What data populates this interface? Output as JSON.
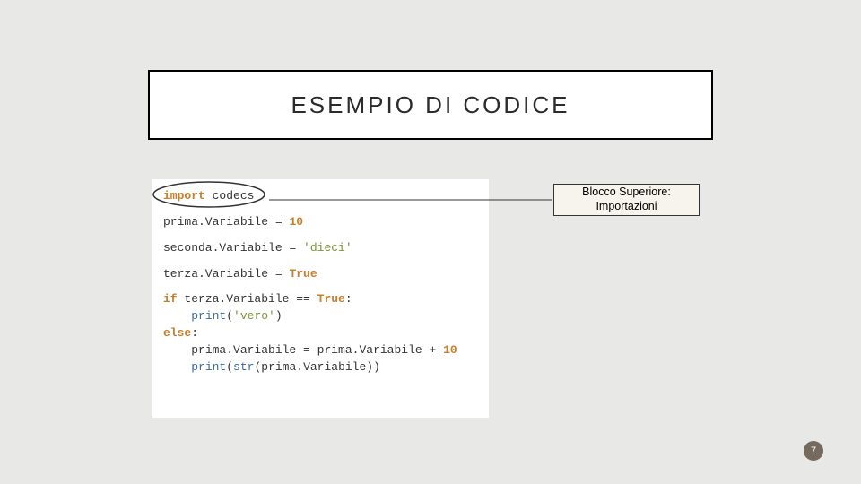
{
  "title": "ESEMPIO DI CODICE",
  "annotation": {
    "line1": "Blocco Superiore:",
    "line2": "Importazioni"
  },
  "code": {
    "l1_kw": "import",
    "l1_rest": " codecs",
    "l2a": "prima.Variabile ",
    "l2op": "= ",
    "l2val": "10",
    "l3a": "seconda.Variabile ",
    "l3op": "= ",
    "l3val": "'dieci'",
    "l4a": "terza.Variabile ",
    "l4op": "= ",
    "l4val": "True",
    "l5_if": "if",
    "l5_mid": " terza.Variabile ",
    "l5_eq": "== ",
    "l5_true": "True",
    "l5_colon": ":",
    "l6_indent": "    ",
    "l6_fn": "print",
    "l6_open": "(",
    "l6_str": "'vero'",
    "l6_close": ")",
    "l7_else": "else",
    "l7_colon": ":",
    "l8_indent": "    ",
    "l8_text": "prima.Variabile ",
    "l8_op": "= ",
    "l8_rhs": "prima.Variabile ",
    "l8_plus": "+ ",
    "l8_num": "10",
    "l9_indent": "    ",
    "l9_fn": "print",
    "l9_open": "(",
    "l9_str_fn": "str",
    "l9_in_open": "(",
    "l9_arg": "prima.Variabile",
    "l9_in_close": ")",
    "l9_close": ")"
  },
  "page_number": "7"
}
